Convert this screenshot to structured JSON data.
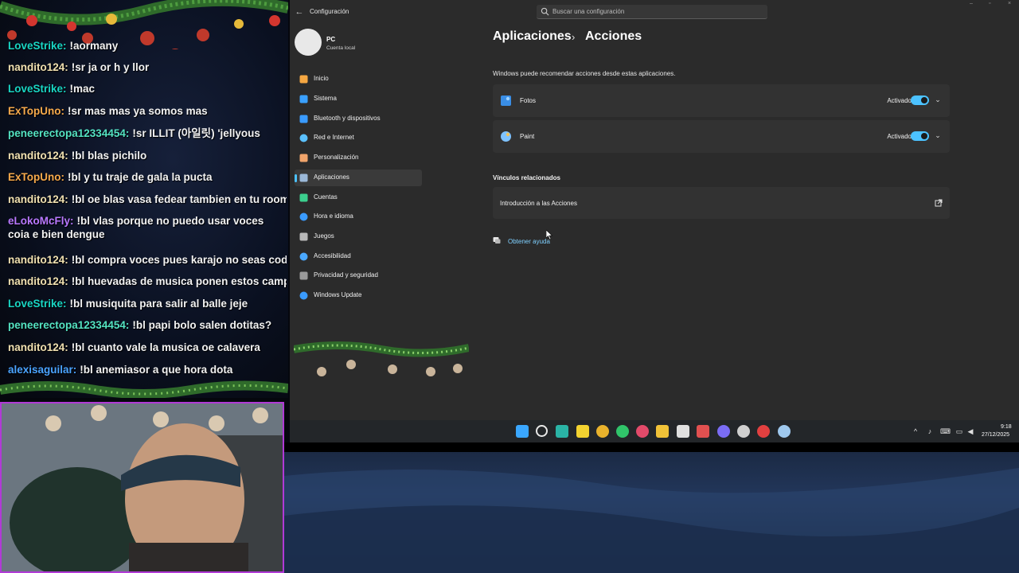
{
  "chat": {
    "messages": [
      {
        "user": "LoveStrike:",
        "text": "!aormany",
        "user_color": "#19d6c4"
      },
      {
        "user": "nandito124:",
        "text": "!sr ja or h y llor",
        "user_color": "#f0e0b0"
      },
      {
        "user": "LoveStrike:",
        "text": "!mac",
        "user_color": "#19d6c4"
      },
      {
        "user": "ExTopUno:",
        "text": "!sr mas mas ya somos mas",
        "user_color": "#f6a94b"
      },
      {
        "user": "peneerectopa12334454:",
        "text": "!sr ILLIT (아일릿) 'jellyous",
        "user_color": "#54e3c2"
      },
      {
        "user": "nandito124:",
        "text": "!bl blas pichilo",
        "user_color": "#f0e0b0"
      },
      {
        "user": "ExTopUno:",
        "text": "!bl y tu traje de gala la pucta",
        "user_color": "#f6a94b"
      },
      {
        "user": "nandito124:",
        "text": "!bl oe blas vasa fedear tambien en tu room confi",
        "user_color": "#f0e0b0"
      },
      {
        "user": "eLokoMcFly:",
        "text": "!bl vlas porque no puedo usar voces coia e bien dengue",
        "user_color": "#b978ff"
      },
      {
        "user": "nandito124:",
        "text": "!bl compra voces pues karajo no seas codo mier",
        "user_color": "#f0e0b0"
      },
      {
        "user": "nandito124:",
        "text": "!bl huevadas de musica ponen estos campesino",
        "user_color": "#f0e0b0"
      },
      {
        "user": "LoveStrike:",
        "text": "!bl musiquita para salir al balle jeje",
        "user_color": "#19d6c4"
      },
      {
        "user": "peneerectopa12334454:",
        "text": "!bl papi bolo salen dotitas?",
        "user_color": "#54e3c2"
      },
      {
        "user": "nandito124:",
        "text": "!bl cuanto vale la musica oe calavera",
        "user_color": "#f0e0b0"
      },
      {
        "user": "alexisaguilar:",
        "text": "!bl anemiasor a que hora dota",
        "user_color": "#4aa3ff"
      }
    ]
  },
  "window": {
    "title": "Configuración",
    "search_placeholder": "Buscar una configuración",
    "profile": {
      "name": "PC",
      "account": "Cuenta local"
    },
    "nav": [
      {
        "label": "Inicio",
        "icon": "home-icon",
        "color": "#f5a742"
      },
      {
        "label": "Sistema",
        "icon": "system-icon",
        "color": "#3aa0ff"
      },
      {
        "label": "Bluetooth y dispositivos",
        "icon": "bluetooth-icon",
        "color": "#3a9bff"
      },
      {
        "label": "Red e Internet",
        "icon": "network-icon",
        "color": "#5bc1ff"
      },
      {
        "label": "Personalización",
        "icon": "brush-icon",
        "color": "#f0a46b"
      },
      {
        "label": "Aplicaciones",
        "icon": "apps-icon",
        "color": "#9bb8d8",
        "selected": true
      },
      {
        "label": "Cuentas",
        "icon": "accounts-icon",
        "color": "#3ccf8e"
      },
      {
        "label": "Hora e idioma",
        "icon": "globe-icon",
        "color": "#3a9bff"
      },
      {
        "label": "Juegos",
        "icon": "gamepad-icon",
        "color": "#b8b8b8"
      },
      {
        "label": "Accesibilidad",
        "icon": "accessibility-icon",
        "color": "#4aa8ff"
      },
      {
        "label": "Privacidad y seguridad",
        "icon": "shield-icon",
        "color": "#9a9a9a"
      },
      {
        "label": "Windows Update",
        "icon": "update-icon",
        "color": "#3a9bff"
      }
    ],
    "breadcrumb": {
      "parent": "Aplicaciones",
      "separator": "›",
      "current": "Acciones"
    },
    "description": "Windows puede recomendar acciones desde estas aplicaciones.",
    "apps": [
      {
        "name": "Fotos",
        "status": "Activado",
        "enabled": true,
        "icon": "photos-icon"
      },
      {
        "name": "Paint",
        "status": "Activado",
        "enabled": true,
        "icon": "paint-icon"
      }
    ],
    "related_title": "Vínculos relacionados",
    "related_link": "Introducción a las Acciones",
    "help_link": "Obtener ayuda",
    "accent": "#4cc2ff"
  },
  "taskbar": {
    "icons": [
      "start-icon",
      "search-icon",
      "edge-icon",
      "sticky-notes-icon",
      "chrome-icon",
      "whatsapp-icon",
      "opera-icon",
      "file-explorer-icon",
      "store-icon",
      "app-icon",
      "discord-icon",
      "obs-icon",
      "app-icon-2",
      "settings-icon"
    ],
    "time": "9:18",
    "date": "27/12/2025"
  }
}
